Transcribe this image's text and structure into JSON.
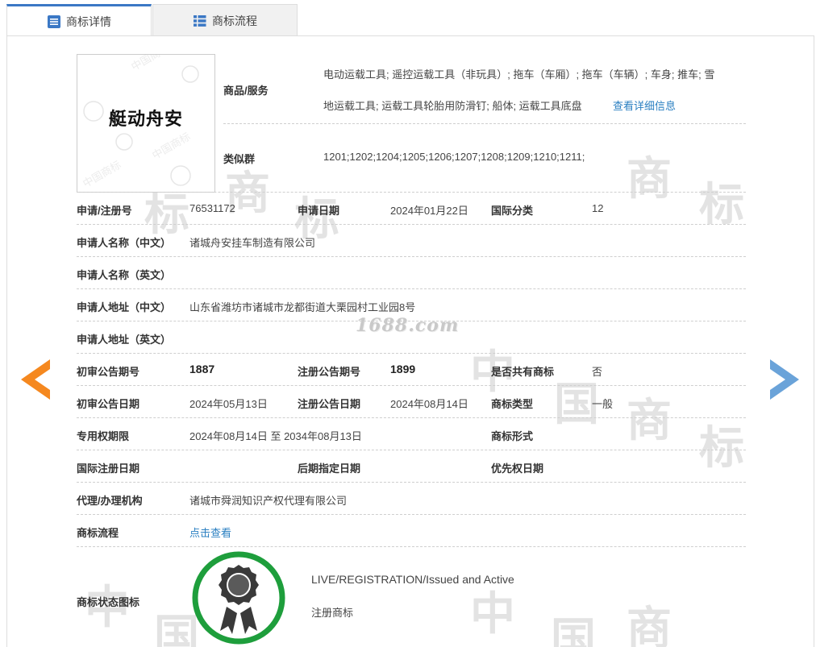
{
  "tabs": [
    {
      "label": "商标详情",
      "active": true
    },
    {
      "label": "商标流程",
      "active": false
    }
  ],
  "logo": {
    "text": "艇动舟安"
  },
  "watermark": {
    "text": "1688.com",
    "glyph_shang": "商",
    "glyph_biao": "标",
    "glyph_zhong": "中",
    "glyph_guo": "国"
  },
  "goods": {
    "label": "商品/服务",
    "line1": "电动运载工具; 遥控运载工具（非玩具）; 拖车（车厢）; 拖车（车辆）; 车身; 推车; 雪",
    "line2": "地运载工具; 运载工具轮胎用防滑钉; 船体; 运载工具底盘",
    "detail_link": "查看详细信息"
  },
  "similar": {
    "label": "类似群",
    "value": "1201;1202;1204;1205;1206;1207;1208;1209;1210;1211;"
  },
  "rows": {
    "reg_no_label": "申请/注册号",
    "reg_no": "76531172",
    "apply_date_label": "申请日期",
    "apply_date": "2024年01月22日",
    "intl_class_label": "国际分类",
    "intl_class": "12",
    "applicant_cn_label": "申请人名称（中文）",
    "applicant_cn": "诸城舟安挂车制造有限公司",
    "applicant_en_label": "申请人名称（英文）",
    "address_cn_label": "申请人地址（中文）",
    "address_cn": "山东省潍坊市诸城市龙都街道大栗园村工业园8号",
    "address_en_label": "申请人地址（英文）",
    "prelim_no_label": "初审公告期号",
    "prelim_no": "1887",
    "reg_pub_no_label": "注册公告期号",
    "reg_pub_no": "1899",
    "shared_label": "是否共有商标",
    "shared": "否",
    "prelim_date_label": "初审公告日期",
    "prelim_date": "2024年05月13日",
    "reg_pub_date_label": "注册公告日期",
    "reg_pub_date": "2024年08月14日",
    "type_label": "商标类型",
    "type": "一般",
    "term_label": "专用权期限",
    "term": "2024年08月14日 至 2034年08月13日",
    "form_label": "商标形式",
    "intl_reg_date_label": "国际注册日期",
    "later_date_label": "后期指定日期",
    "priority_label": "优先权日期",
    "agent_label": "代理/办理机构",
    "agent": "诸城市舜润知识产权代理有限公司",
    "flow_label": "商标流程",
    "flow_link": "点击查看",
    "status_icon_label": "商标状态图标",
    "status_en": "LIVE/REGISTRATION/Issued and Active",
    "status_cn": "注册商标"
  },
  "colors": {
    "accent": "#3b78c5",
    "link": "#2a7fc1",
    "arrow_left": "#f5881f",
    "arrow_right": "#6aa3d9",
    "badge_ring": "#1e9e3c"
  },
  "icons": {
    "tab_detail": "list-icon",
    "tab_flow": "grid-icon",
    "prev": "prev-arrow-icon",
    "next": "next-arrow-icon",
    "status": "award-badge-icon"
  }
}
